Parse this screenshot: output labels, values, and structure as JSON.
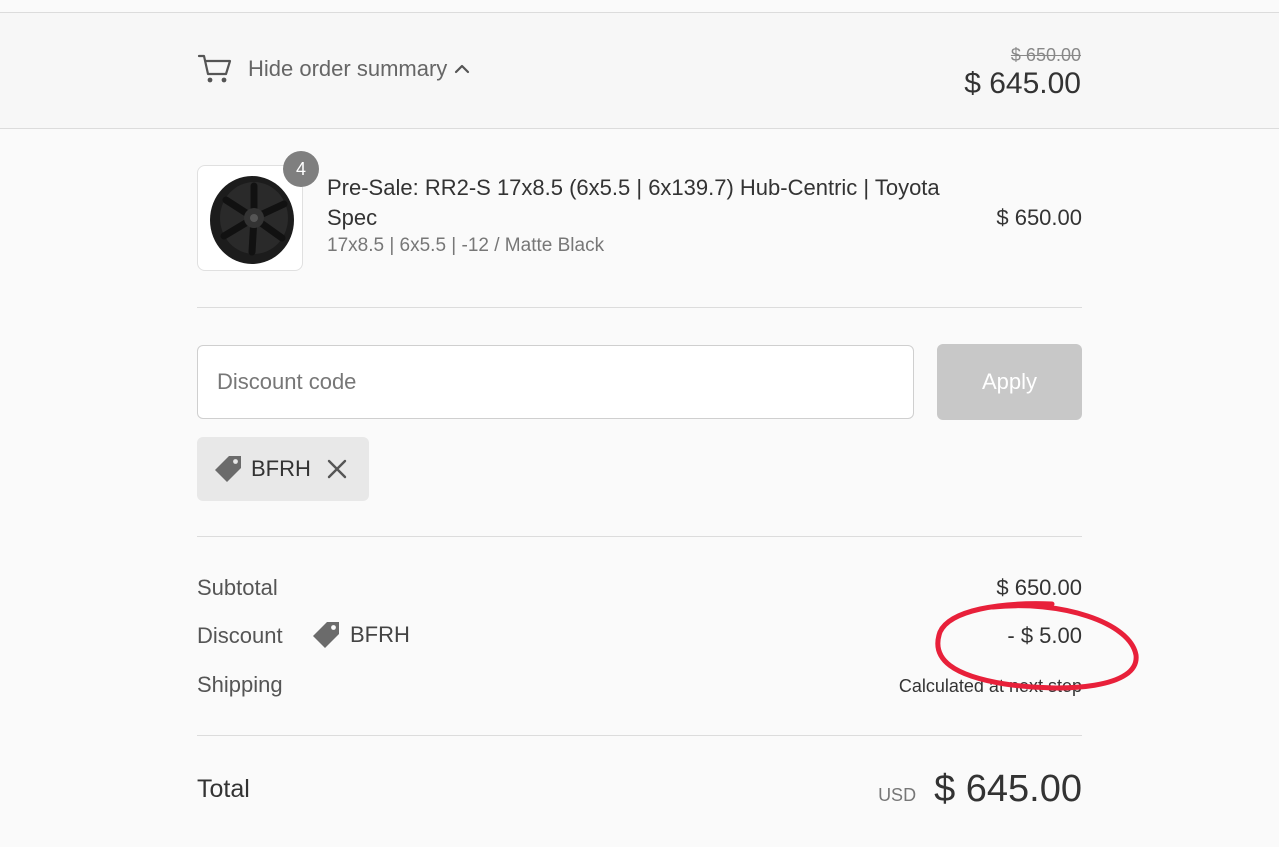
{
  "header": {
    "toggle_label": "Hide order summary",
    "original_price": "$ 650.00",
    "total": "$ 645.00"
  },
  "product": {
    "quantity": "4",
    "title": "Pre-Sale: RR2-S 17x8.5 (6x5.5 | 6x139.7) Hub-Centric | Toyota Spec",
    "variant": "17x8.5 | 6x5.5 | -12 / Matte Black",
    "price": "$ 650.00"
  },
  "discount_form": {
    "placeholder": "Discount code",
    "apply_label": "Apply",
    "applied_code": "BFRH"
  },
  "summary": {
    "subtotal_label": "Subtotal",
    "subtotal_value": "$ 650.00",
    "discount_label": "Discount",
    "discount_code": "BFRH",
    "discount_value": "- $ 5.00",
    "shipping_label": "Shipping",
    "shipping_value": "Calculated at next step"
  },
  "total": {
    "label": "Total",
    "currency": "USD",
    "amount": "$ 645.00"
  },
  "colors": {
    "annotation": "#e8203a",
    "apply_disabled": "#c8c8c8",
    "badge": "#7f7f7f"
  }
}
